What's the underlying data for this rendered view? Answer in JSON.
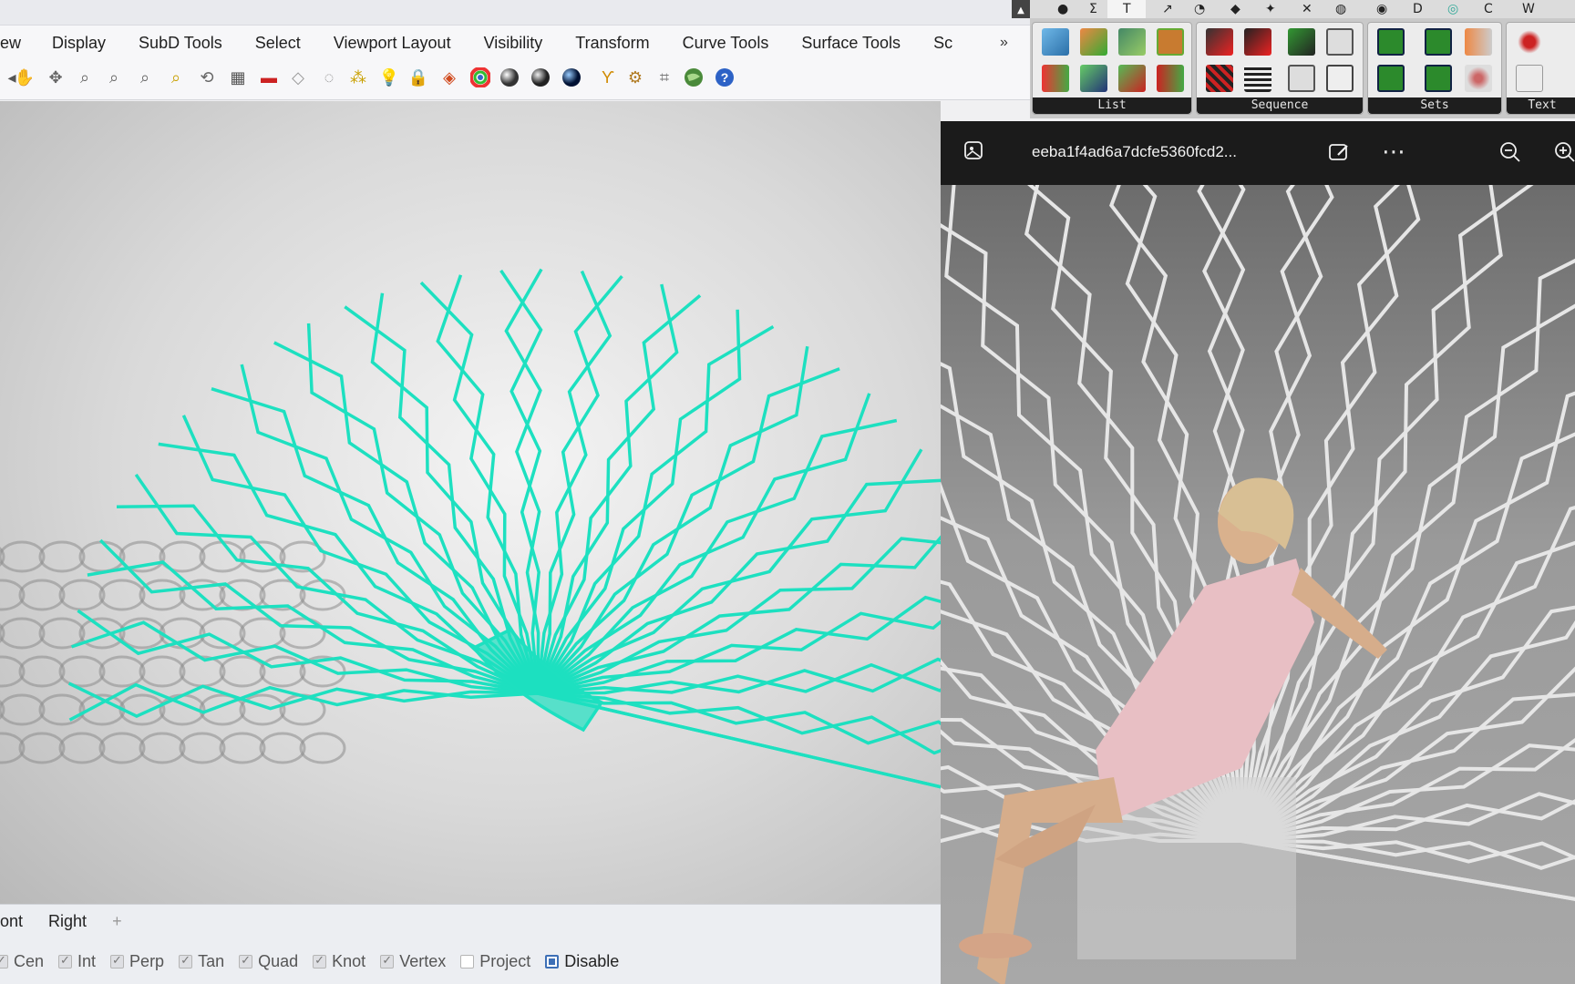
{
  "menubar": {
    "items": [
      "ew",
      "Display",
      "SubD Tools",
      "Select",
      "Viewport Layout",
      "Visibility",
      "Transform",
      "Curve Tools",
      "Surface Tools",
      "Sc"
    ],
    "overflow": "»"
  },
  "grasshopper": {
    "groups": [
      {
        "label": "List"
      },
      {
        "label": "Sequence"
      },
      {
        "label": "Sets"
      },
      {
        "label": "Text"
      }
    ]
  },
  "viewport_tabs": {
    "items": [
      "ont",
      "Right"
    ],
    "add": "+"
  },
  "osnap": {
    "items": [
      {
        "label": "Cen",
        "state": "checked"
      },
      {
        "label": "Int",
        "state": "checked"
      },
      {
        "label": "Perp",
        "state": "checked"
      },
      {
        "label": "Tan",
        "state": "checked"
      },
      {
        "label": "Quad",
        "state": "checked"
      },
      {
        "label": "Knot",
        "state": "checked"
      },
      {
        "label": "Vertex",
        "state": "checked"
      },
      {
        "label": "Project",
        "state": "unchecked"
      },
      {
        "label": "Disable",
        "state": "active"
      }
    ]
  },
  "viewer": {
    "filename": "eeba1f4ad6a7dcfe5360fcd2..."
  },
  "colors": {
    "model_accent": "#1de0c0",
    "viewer_bg": "#1b1b1b",
    "toolbar_bg": "#f7f7f9"
  }
}
